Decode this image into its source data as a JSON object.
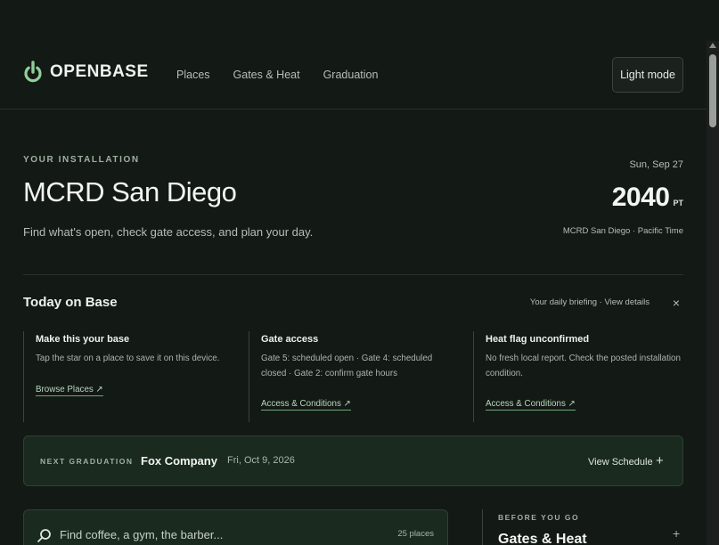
{
  "header": {
    "brand": "OPENBASE",
    "nav": [
      "Places",
      "Gates & Heat",
      "Graduation"
    ],
    "light_mode_label": "Light mode"
  },
  "hero": {
    "eyebrow": "YOUR INSTALLATION",
    "title": "MCRD San Diego",
    "subtitle": "Find what's open, check gate access, and plan your day.",
    "date": "Sun, Sep 27",
    "time": "2040",
    "tz": "PT",
    "location": "MCRD San Diego · Pacific Time"
  },
  "today": {
    "title": "Today on Base",
    "briefing": "Your daily briefing · View details",
    "close": "×",
    "cards": [
      {
        "title": "Make this your base",
        "body": "Tap the star on a place to save it on this device.",
        "link": "Browse Places ↗"
      },
      {
        "title": "Gate access",
        "body": "Gate 5: scheduled open · Gate 4: scheduled closed · Gate 2: confirm gate hours",
        "link": "Access & Conditions ↗"
      },
      {
        "title": "Heat flag unconfirmed",
        "body": "No fresh local report. Check the posted installation condition.",
        "link": "Access & Conditions ↗"
      }
    ]
  },
  "graduation": {
    "eyebrow": "NEXT GRADUATION",
    "company": "Fox Company",
    "date": "Fri, Oct 9, 2026",
    "view_label": "View Schedule",
    "plus": "+"
  },
  "search": {
    "placeholder": "Find coffee, a gym, the barber...",
    "count": "25 places"
  },
  "before_you_go": {
    "eyebrow": "BEFORE YOU GO",
    "title": "Gates & Heat",
    "plus": "+"
  },
  "colors": {
    "background": "#131915",
    "accent": "#7fc08a",
    "panel": "#1a2a1f"
  },
  "icons": {
    "brand": "power-icon",
    "search": "search-icon",
    "close": "close-icon"
  }
}
